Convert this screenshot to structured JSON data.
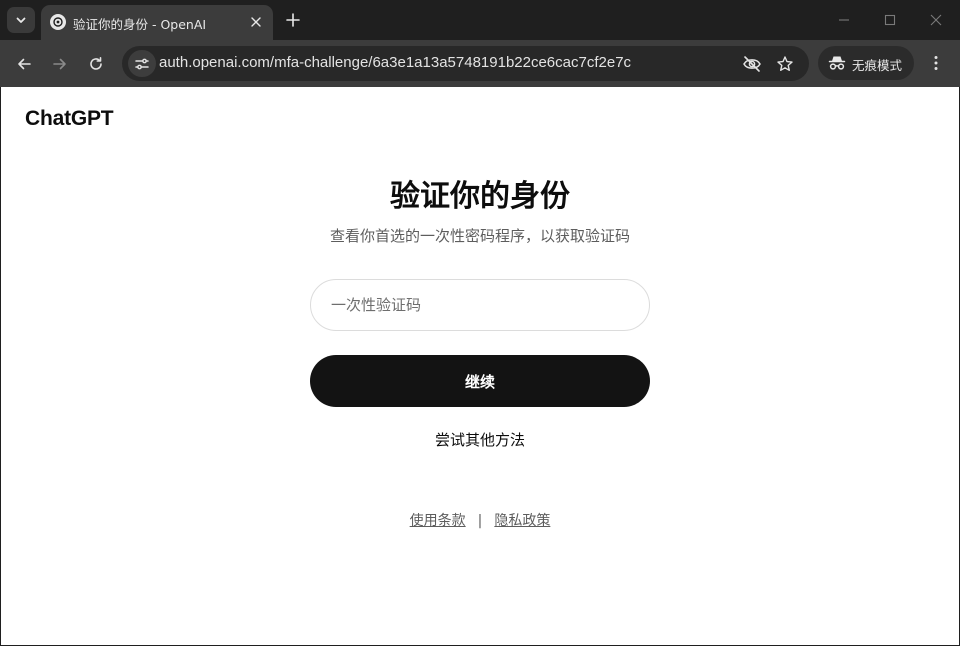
{
  "browser": {
    "tab": {
      "title": "验证你的身份 - OpenAI",
      "favicon": "openai-icon"
    },
    "address_bar": {
      "url": "auth.openai.com/mfa-challenge/6a3e1a13a5748191b22ce6cac7cf2e7c"
    },
    "incognito_label": "无痕模式",
    "icons": {
      "tab_list": "chevron-down-icon",
      "tab_close": "close-icon",
      "new_tab": "plus-icon",
      "minimize": "minimize-icon",
      "maximize": "maximize-icon",
      "close_window": "close-icon",
      "back": "back-arrow-icon",
      "forward": "forward-arrow-icon",
      "reload": "reload-icon",
      "site_info": "site-info-icon",
      "tracking_protection": "eye-slash-icon",
      "bookmark": "star-icon",
      "incognito": "incognito-icon",
      "menu": "kebab-menu-icon"
    }
  },
  "page": {
    "logo": "ChatGPT",
    "heading": "验证你的身份",
    "subheading": "查看你首选的一次性密码程序，以获取验证码",
    "otp_input": {
      "placeholder": "一次性验证码",
      "value": ""
    },
    "continue_button": "继续",
    "alt_method_link": "尝试其他方法",
    "footer": {
      "terms": "使用条款",
      "separator": "|",
      "privacy": "隐私政策"
    }
  },
  "colors": {
    "tab_strip": "#1f1f1f",
    "toolbar": "#3c3c3c",
    "omnibox": "#282828",
    "primary_button": "#131313",
    "page_bg": "#ffffff"
  }
}
